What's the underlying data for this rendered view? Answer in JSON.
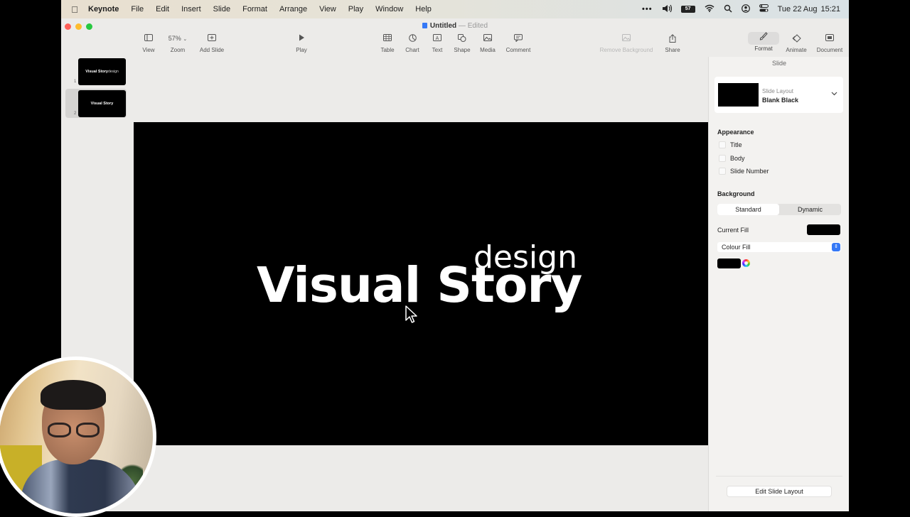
{
  "menubar": {
    "app": "Keynote",
    "items": [
      "File",
      "Edit",
      "Insert",
      "Slide",
      "Format",
      "Arrange",
      "View",
      "Play",
      "Window",
      "Help"
    ],
    "battery": "57",
    "date": "Tue 22 Aug",
    "time": "15:21"
  },
  "window": {
    "title": "Untitled",
    "separator": "—",
    "status": "Edited"
  },
  "toolbar": {
    "zoom_value": "57%",
    "view": "View",
    "zoom": "Zoom",
    "add_slide": "Add Slide",
    "play": "Play",
    "table": "Table",
    "chart": "Chart",
    "text": "Text",
    "shape": "Shape",
    "media": "Media",
    "comment": "Comment",
    "remove_background": "Remove Background",
    "share": "Share",
    "format": "Format",
    "animate": "Animate",
    "document": "Document"
  },
  "navigator": {
    "slides": [
      {
        "number": "1",
        "main": "Visual Story",
        "sub": "design"
      },
      {
        "number": "2",
        "main": "Visual Story",
        "sub": ""
      }
    ]
  },
  "slide": {
    "title": "Visual Story",
    "subtitle": "design",
    "background": "#000000"
  },
  "inspector": {
    "header": "Slide",
    "layout_label": "Slide Layout",
    "layout_name": "Blank Black",
    "appearance": "Appearance",
    "checkboxes": [
      "Title",
      "Body",
      "Slide Number"
    ],
    "background": "Background",
    "segments": [
      "Standard",
      "Dynamic"
    ],
    "current_fill": "Current Fill",
    "fill_type": "Colour Fill",
    "edit_layout": "Edit Slide Layout"
  },
  "colors": {
    "accent": "#3478f6",
    "close": "#fe5f57",
    "minimize": "#febc2e",
    "zoom": "#28c840"
  }
}
